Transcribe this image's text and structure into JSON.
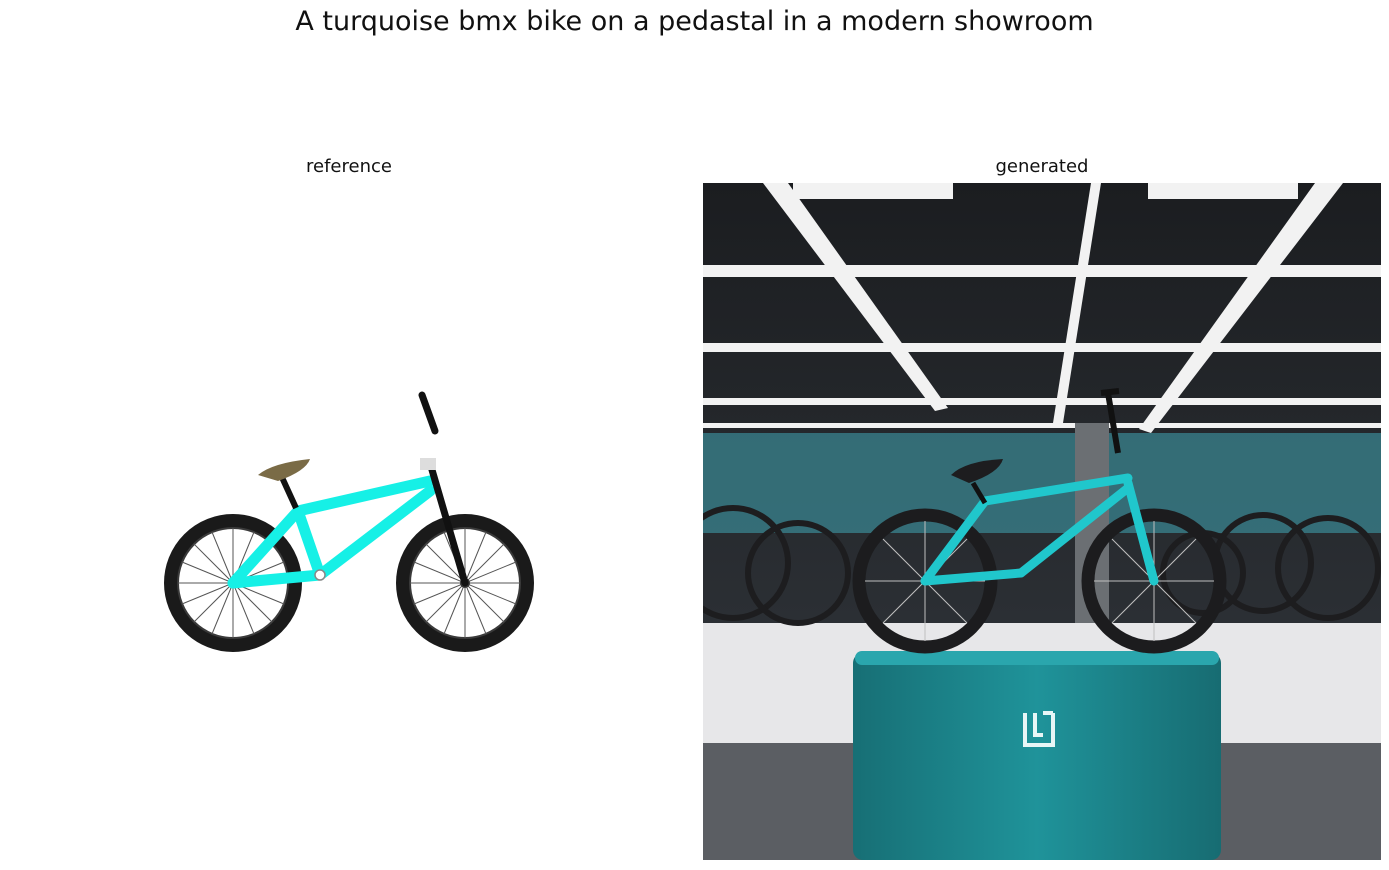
{
  "figure": {
    "title": "A turquoise bmx bike on a pedastal in a modern showroom"
  },
  "panels": [
    {
      "caption": "reference"
    },
    {
      "caption": "generated"
    }
  ],
  "colors": {
    "bike_turquoise": "#16f0e6",
    "pedestal_teal": "#1e8c93",
    "tire_black": "#1a1a1a"
  }
}
